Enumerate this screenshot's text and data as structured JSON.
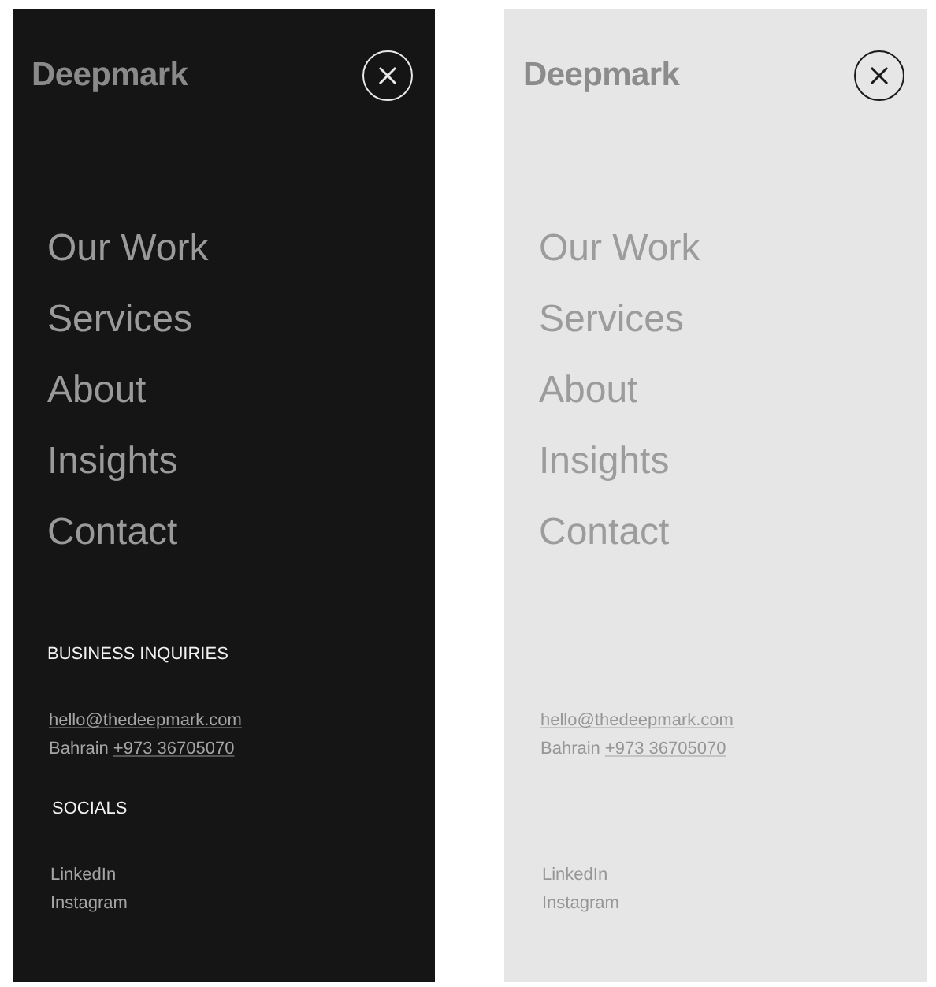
{
  "panels": [
    {
      "kind": "dark",
      "logo": "Deepmark",
      "nav": [
        "Our Work",
        "Services",
        "About",
        "Insights",
        "Contact"
      ],
      "contact": {
        "heading": "BUSINESS INQUIRIES",
        "email": "hello@thedeepmark.com",
        "location": "Bahrain",
        "phone": "+973 36705070"
      },
      "socials": {
        "heading": "SOCIALS",
        "links": [
          "LinkedIn",
          "Instagram"
        ]
      }
    },
    {
      "kind": "light",
      "logo": "Deepmark",
      "nav": [
        "Our Work",
        "Services",
        "About",
        "Insights",
        "Contact"
      ],
      "contact": {
        "email": "hello@thedeepmark.com",
        "location": "Bahrain",
        "phone": "+973 36705070"
      },
      "socials": {
        "links": [
          "LinkedIn",
          "Instagram"
        ]
      }
    }
  ]
}
